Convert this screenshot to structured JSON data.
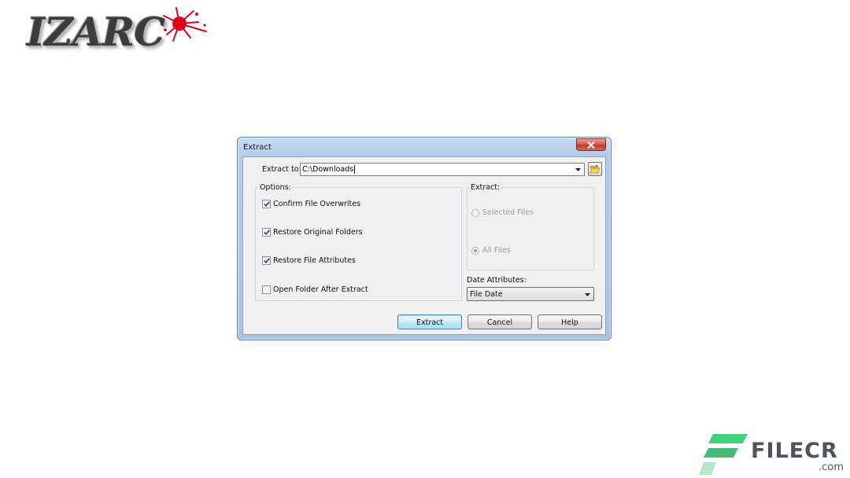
{
  "brand": {
    "app_logo_text": "IZARC",
    "watermark_name": "FILECR",
    "watermark_domain": ".com",
    "colors": {
      "splat": "#e0001b",
      "filecr_green": "#2ecc71",
      "filecr_text": "#4a5560"
    }
  },
  "dialog": {
    "title": "Extract",
    "close_icon": "close-icon",
    "extract_to": {
      "label": "Extract to:",
      "value": "C:\\Downloads",
      "browse_icon": "folder-open-icon"
    },
    "options": {
      "title": "Options:",
      "items": [
        {
          "label": "Confirm File Overwrites",
          "checked": true
        },
        {
          "label": "Restore Original Folders",
          "checked": true
        },
        {
          "label": "Restore File Attributes",
          "checked": true
        },
        {
          "label": "Open Folder After Extract",
          "checked": false
        }
      ]
    },
    "extract_group": {
      "title": "Extract:",
      "radios": [
        {
          "label": "Selected Files",
          "selected": false,
          "enabled": false
        },
        {
          "label": "All Files",
          "selected": true,
          "enabled": false
        }
      ]
    },
    "date_attributes": {
      "label": "Date Attributes:",
      "selected": "File Date"
    },
    "buttons": {
      "extract": "Extract",
      "cancel": "Cancel",
      "help": "Help"
    }
  }
}
